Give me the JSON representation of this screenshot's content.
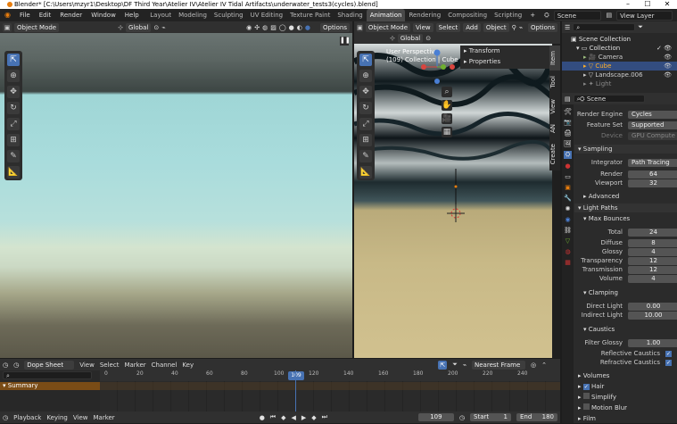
{
  "title": "Blender* [C:\\Users\\mzyr1\\Desktop\\DF Third Year\\Atelier IV\\Atelier IV Tidal Artifacts\\underwater_tests3(cycles).blend]",
  "menu": [
    "File",
    "Edit",
    "Render",
    "Window",
    "Help"
  ],
  "workspaces": [
    "Layout",
    "Modeling",
    "Sculpting",
    "UV Editing",
    "Texture Paint",
    "Shading",
    "Animation",
    "Rendering",
    "Compositing",
    "Scripting"
  ],
  "active_workspace": "Animation",
  "scene_name": "Scene",
  "view_layer": "View Layer",
  "left_vp": {
    "mode": "Object Mode",
    "orientation": "Global",
    "options": "Options"
  },
  "right_vp": {
    "mode": "Object Mode",
    "view": "View",
    "select": "Select",
    "add": "Add",
    "object": "Object",
    "orientation": "Global",
    "options": "Options",
    "overlay_line1": "User Perspective",
    "overlay_line2": "(109) Collection | Cube",
    "tabs": [
      "Item",
      "Tool",
      "View",
      "AN",
      "Create"
    ],
    "transform": "Transform",
    "properties": "Properties"
  },
  "outliner": {
    "scene_collection": "Scene Collection",
    "items": [
      "Collection",
      "Camera",
      "Cube",
      "Landscape.006",
      "Light"
    ]
  },
  "props": {
    "scene": "Scene",
    "render_engine_lbl": "Render Engine",
    "render_engine": "Cycles",
    "feature_set_lbl": "Feature Set",
    "feature_set": "Supported",
    "device_lbl": "Device",
    "device": "GPU Compute",
    "sampling": "Sampling",
    "integrator_lbl": "Integrator",
    "integrator": "Path Tracing",
    "render_lbl": "Render",
    "render": "64",
    "viewport_lbl": "Viewport",
    "viewport": "32",
    "advanced": "Advanced",
    "light_paths": "Light Paths",
    "max_bounces": "Max Bounces",
    "total_lbl": "Total",
    "total": "24",
    "diffuse_lbl": "Diffuse",
    "diffuse": "8",
    "glossy_lbl": "Glossy",
    "glossy": "4",
    "transparency_lbl": "Transparency",
    "transparency": "12",
    "transmission_lbl": "Transmission",
    "transmission": "12",
    "volume_lbl": "Volume",
    "volume": "4",
    "clamping": "Clamping",
    "direct_lbl": "Direct Light",
    "direct": "0.00",
    "indirect_lbl": "Indirect Light",
    "indirect": "10.00",
    "caustics": "Caustics",
    "filter_glossy_lbl": "Filter Glossy",
    "filter_glossy": "1.00",
    "reflective_caustics": "Reflective Caustics",
    "refractive_caustics": "Refractive Caustics",
    "volumes": "Volumes",
    "hair": "Hair",
    "simplify": "Simplify",
    "motion_blur": "Motion Blur",
    "film": "Film"
  },
  "dopesheet": {
    "mode": "Dope Sheet",
    "menu": [
      "View",
      "Select",
      "Marker",
      "Channel",
      "Key"
    ],
    "snap": "Nearest Frame",
    "summary": "Summary",
    "ticks": [
      "0",
      "20",
      "40",
      "60",
      "80",
      "100",
      "120",
      "140",
      "160",
      "180",
      "200",
      "220",
      "240"
    ],
    "current_frame": "109"
  },
  "playback": {
    "menu": [
      "Playback",
      "Keying",
      "View",
      "Marker"
    ],
    "frame": "109",
    "start_lbl": "Start",
    "start": "1",
    "end_lbl": "End",
    "end": "180"
  }
}
